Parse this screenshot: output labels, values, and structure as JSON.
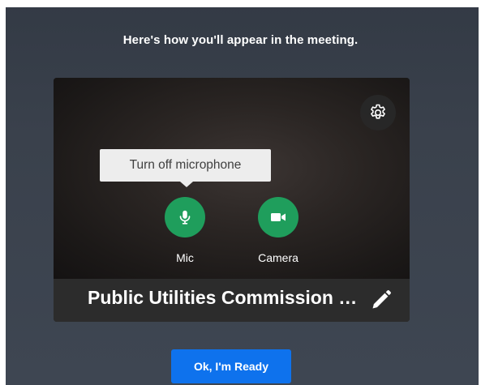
{
  "dialog": {
    "heading": "Here's how you'll appear in the meeting."
  },
  "preview": {
    "settings_icon": "gear-icon",
    "tooltip": "Turn off microphone",
    "controls": {
      "mic": {
        "label": "Mic",
        "icon": "microphone-icon",
        "state": "on"
      },
      "camera": {
        "label": "Camera",
        "icon": "video-camera-icon",
        "state": "off"
      }
    },
    "display_name": "Public Utilities Commission of Nevada",
    "edit_icon": "pencil-icon"
  },
  "actions": {
    "ready_label": "Ok, I'm Ready"
  },
  "colors": {
    "background": "#3a414c",
    "control_green": "#1f9e5c",
    "primary_blue": "#0e72ed",
    "tooltip_bg": "#ededed"
  }
}
